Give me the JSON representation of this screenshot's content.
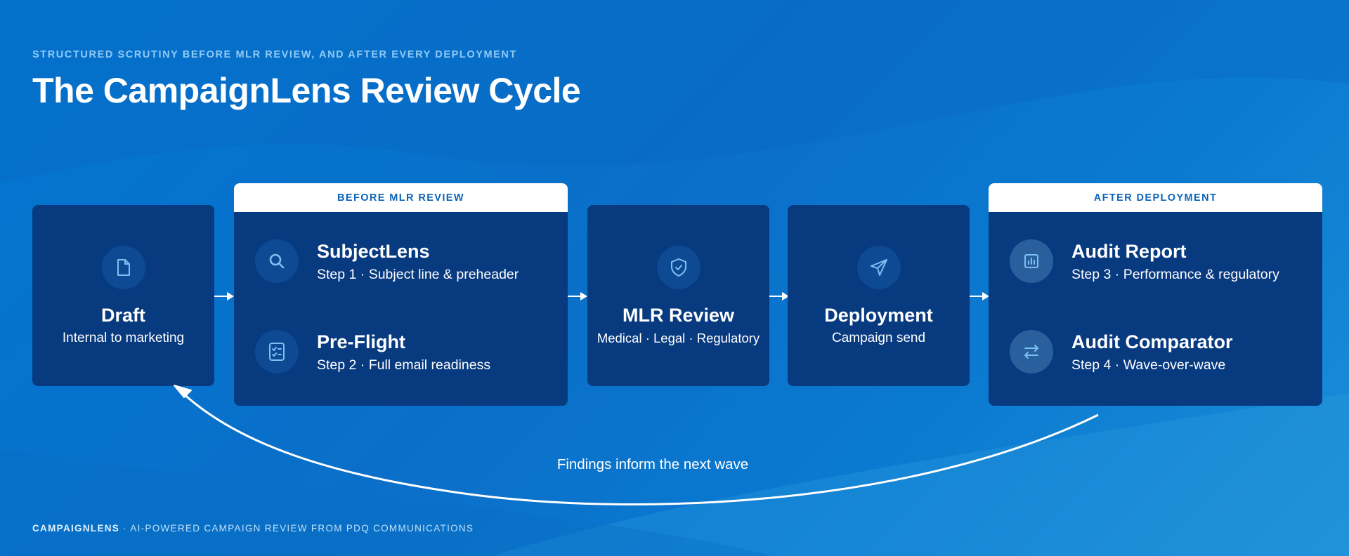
{
  "header": {
    "eyebrow": "STRUCTURED SCRUTINY BEFORE MLR REVIEW, AND AFTER EVERY DEPLOYMENT",
    "title": "The CampaignLens Review Cycle"
  },
  "draft": {
    "title": "Draft",
    "subtitle": "Internal to marketing",
    "icon": "document-icon"
  },
  "before_group": {
    "header": "BEFORE MLR REVIEW",
    "steps": [
      {
        "title": "SubjectLens",
        "subtitle": "Step 1 · Subject line & preheader",
        "icon": "search-icon"
      },
      {
        "title": "Pre-Flight",
        "subtitle": "Step 2 · Full email readiness",
        "icon": "checklist-icon"
      }
    ]
  },
  "mlr": {
    "title": "MLR Review",
    "subtitle": "Medical · Legal · Regulatory",
    "icon": "shield-check-icon"
  },
  "deployment": {
    "title": "Deployment",
    "subtitle": "Campaign send",
    "icon": "paper-plane-icon"
  },
  "after_group": {
    "header": "AFTER DEPLOYMENT",
    "steps": [
      {
        "title": "Audit Report",
        "subtitle": "Step 3 · Performance & regulatory",
        "icon": "bar-chart-icon"
      },
      {
        "title": "Audit Comparator",
        "subtitle": "Step 4 · Wave-over-wave",
        "icon": "swap-arrows-icon"
      }
    ]
  },
  "loop_label": "Findings inform the next wave",
  "footer": {
    "brand": "CAMPAIGNLENS",
    "text": " · AI-POWERED CAMPAIGN REVIEW FROM PDQ COMMUNICATIONS"
  },
  "colors": {
    "background": "#0276d2",
    "card": "#083a80",
    "header_text": "#0a63b8",
    "eyebrow": "#8fcaf5"
  }
}
